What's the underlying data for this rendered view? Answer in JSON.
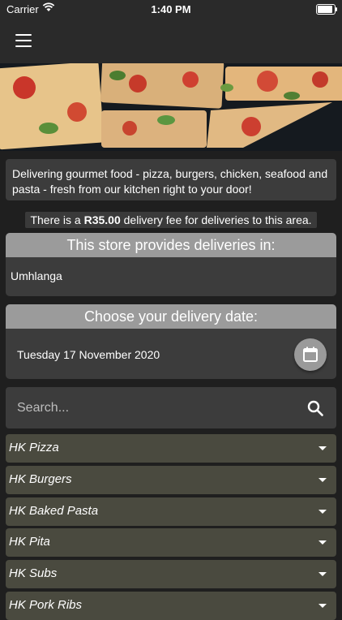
{
  "status": {
    "carrier": "Carrier",
    "time": "1:40 PM"
  },
  "intro": "Delivering gourmet food - pizza, burgers, chicken, seafood and pasta - fresh from our kitchen right to your door!",
  "fee": {
    "prefix": "There is a",
    "amount": "R35.00",
    "suffix": "delivery fee for deliveries to this area."
  },
  "delivery_areas": {
    "header": "This store provides deliveries in:",
    "area": "Umhlanga"
  },
  "delivery_date": {
    "header": "Choose your delivery date:",
    "value": "Tuesday 17 November 2020"
  },
  "search": {
    "placeholder": "Search..."
  },
  "categories": [
    "HK Pizza",
    "HK Burgers",
    "HK Baked Pasta",
    "HK Pita",
    "HK Subs",
    "HK Pork Ribs"
  ]
}
